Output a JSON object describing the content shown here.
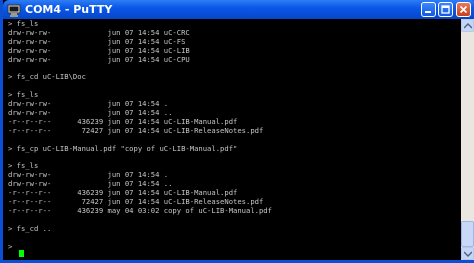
{
  "window": {
    "title": "COM4 - PuTTY",
    "icon": "putty-terminal-icon"
  },
  "terminal": {
    "lines": [
      "> fs_ls",
      "drw-rw-rw-             jun 07 14:54 uC-CRC",
      "drw-rw-rw-             jun 07 14:54 uC-FS",
      "drw-rw-rw-             jun 07 14:54 uC-LIB",
      "drw-rw-rw-             jun 07 14:54 uC-CPU",
      "",
      "> fs_cd uC-LIB\\Doc",
      "",
      "> fs_ls",
      "drw-rw-rw-             jun 07 14:54 .",
      "drw-rw-rw-             jun 07 14:54 ..",
      "-r--r--r--      436239 jun 07 14:54 uC-LIB-Manual.pdf",
      "-r--r--r--       72427 jun 07 14:54 uC-LIB-ReleaseNotes.pdf",
      "",
      "> fs_cp uC-LIB-Manual.pdf \"copy of uC-LIB-Manual.pdf\"",
      "",
      "> fs_ls",
      "drw-rw-rw-             jun 07 14:54 .",
      "drw-rw-rw-             jun 07 14:54 ..",
      "-r--r--r--      436239 jun 07 14:54 uC-LIB-Manual.pdf",
      "-r--r--r--       72427 jun 07 14:54 uC-LIB-ReleaseNotes.pdf",
      "-r--r--r--      436239 may 04 03:02 copy of uC-LIB-Manual.pdf",
      "",
      "> fs_cd ..",
      "",
      ">"
    ],
    "cursor_color": "#00ff00",
    "text_color": "#c8c8c8",
    "background_color": "#000000"
  },
  "colors": {
    "titlebar": "#0a58e8",
    "close_button": "#c7401d"
  }
}
